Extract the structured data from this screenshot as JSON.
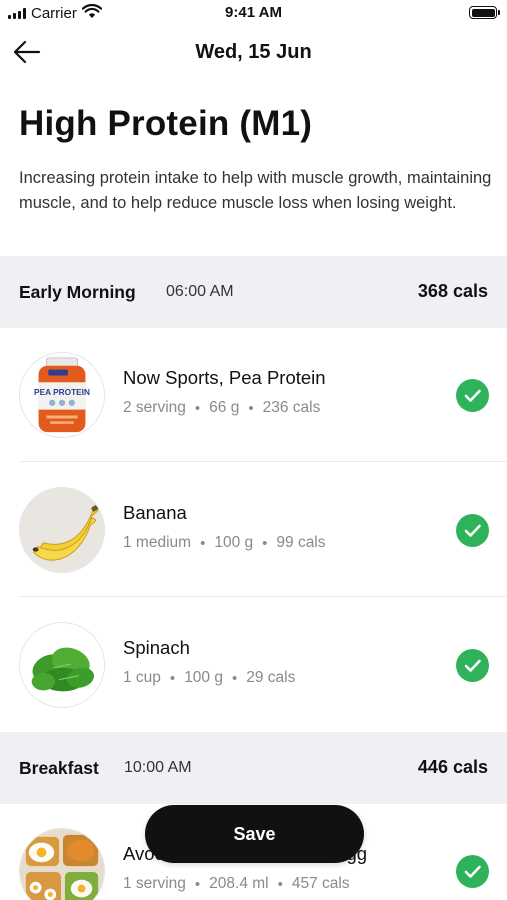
{
  "status_bar": {
    "carrier": "Carrier",
    "time": "9:41 AM",
    "battery_level": 1.0
  },
  "nav": {
    "title": "Wed, 15 Jun",
    "back_icon": "arrow-left-icon"
  },
  "plan": {
    "title": "High Protein (M1)",
    "description": "Increasing protein intake to help with muscle growth, maintaining muscle, and to help reduce muscle loss when losing weight."
  },
  "meals": [
    {
      "name": "Early Morning",
      "time": "06:00 AM",
      "cals": "368 cals",
      "items": [
        {
          "name": "Now Sports, Pea Protein",
          "serving": "2 serving",
          "amount": "66 g",
          "cals": "236 cals",
          "image_label": "PEA PROTEIN",
          "checked": true
        },
        {
          "name": "Banana",
          "serving": "1 medium",
          "amount": "100 g",
          "cals": "99 cals",
          "checked": true
        },
        {
          "name": "Spinach",
          "serving": "1 cup",
          "amount": "100 g",
          "cals": "29 cals",
          "checked": true
        }
      ]
    },
    {
      "name": "Breakfast",
      "time": "10:00 AM",
      "cals": "446 cals",
      "items": [
        {
          "name": "Avocado Toast with Fried Egg",
          "serving": "1 serving",
          "amount": "208.4 ml",
          "cals": "457 cals",
          "checked": true
        }
      ]
    }
  ],
  "meta_separator": "•",
  "save_label": "Save",
  "colors": {
    "accent_check": "#2fb35a",
    "section_bg": "#eef0f3",
    "save_bg": "#111111"
  }
}
